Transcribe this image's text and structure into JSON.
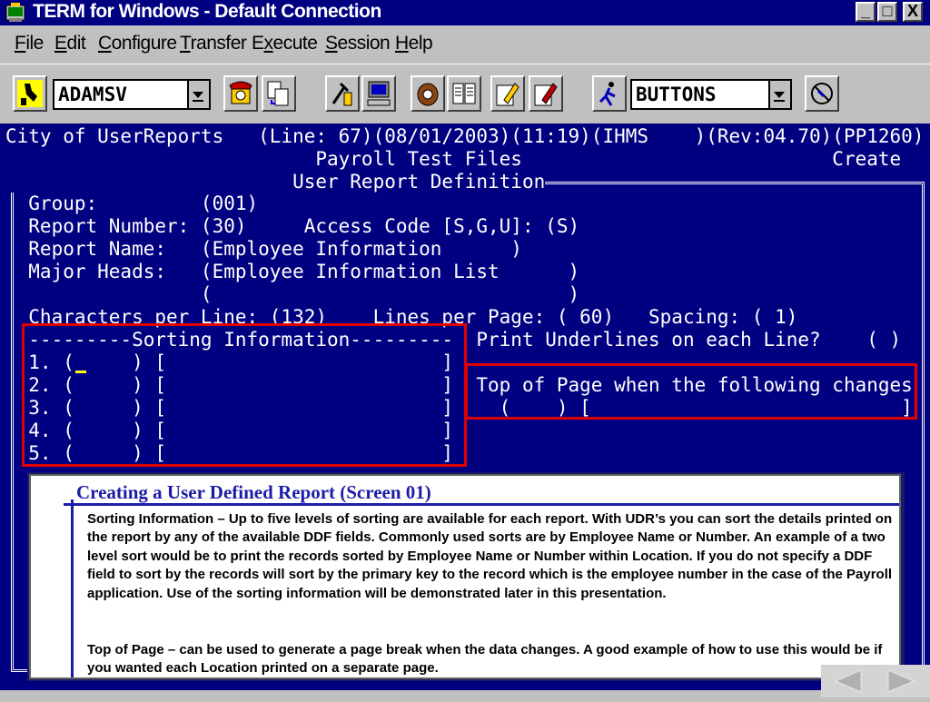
{
  "window": {
    "title": "TERM for Windows - Default Connection",
    "minimize": "_",
    "maximize": "□",
    "close": "X"
  },
  "menu": {
    "items": [
      {
        "underline": "F",
        "rest": "ile"
      },
      {
        "underline": "E",
        "rest": "dit"
      },
      {
        "underline": "C",
        "rest": "onfigure"
      },
      {
        "underline": "T",
        "rest": "ransfer"
      },
      {
        "pre": "E",
        "underline": "x",
        "rest": "ecute"
      },
      {
        "underline": "S",
        "rest": "ession"
      },
      {
        "underline": "H",
        "rest": "elp"
      }
    ]
  },
  "toolbar": {
    "connection_combo_value": "ADAMSV",
    "buttons_combo_value": "BUTTONS"
  },
  "terminal": {
    "lines": [
      "City of UserReports   (Line: 67)(08/01/2003)(11:19)(IHMS    )(Rev:04.70)(PP1260)",
      "                           Payroll Test Files                           Create",
      "                         User Report Definition",
      "  Group:         (001)",
      "  Report Number: (30)     Access Code [S,G,U]: (S)",
      "  Report Name:   (Employee Information      )",
      "  Major Heads:   (Employee Information List      )",
      "                 (                               )",
      "  Characters per Line: (132)    Lines per Page: ( 60)   Spacing: ( 1)",
      "  ---------Sorting Information---------  Print Underlines on each Line?    ( )",
      "  1. (     ) [                        ]",
      "  2. (     ) [                        ]  Top of Page when the following changes",
      "  3. (     ) [                        ]    (    ) [                           ]",
      "  4. (     ) [                        ]",
      "  5. (     ) [                        ]"
    ]
  },
  "overlay": {
    "title": "Creating a User Defined Report  (Screen 01)",
    "para1": "Sorting Information – Up to five levels of sorting are available for each report. With UDR’s you can sort the details printed on the report by any of the available DDF fields.  Commonly used sorts are by Employee Name or Number.  An example of a two level sort would be to print the records sorted by Employee Name or Number within Location.   If you do not specify a DDF field to sort by the records will sort by the primary key to the record which is the employee number in the case of the Payroll application.  Use of the sorting information will be demonstrated later in this presentation.",
    "para2": "Top of Page – can be used to generate a page break when the data changes.  A good example of how to use this would be if you wanted each Location printed on a separate page."
  },
  "colors": {
    "terminal_bg": "#000080",
    "highlight_box": "#e00000",
    "title_blue": "#1c1ca8"
  }
}
